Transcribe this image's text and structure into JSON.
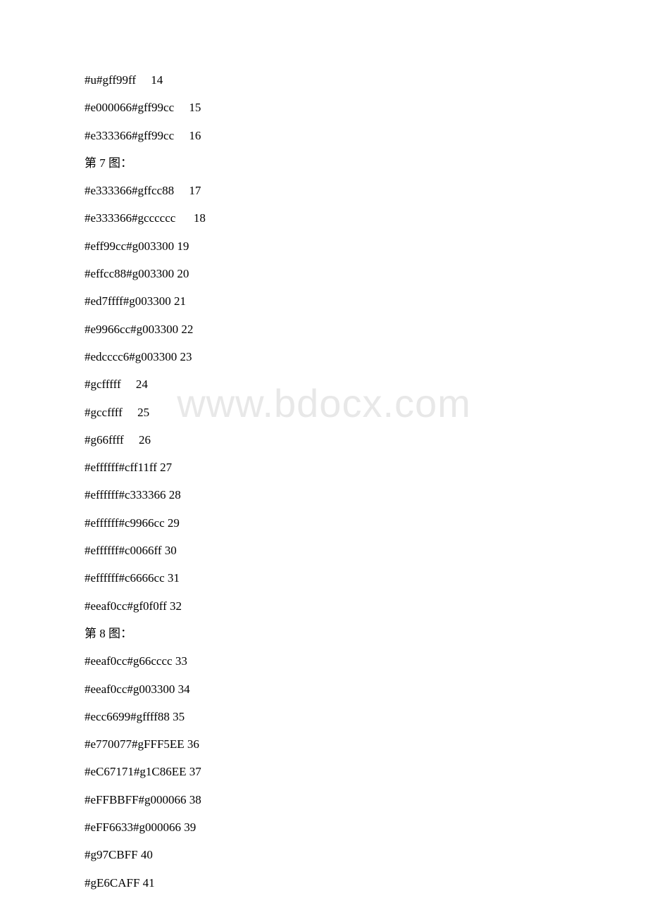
{
  "watermark": "www.bdocx.com",
  "lines": [
    "#u#gff99ff     14",
    "#e000066#gff99cc     15",
    "#e333366#gff99cc     16",
    "第 7 图：",
    "#e333366#gffcc88     17",
    "#e333366#gcccccc      18",
    "#eff99cc#g003300 19",
    "#effcc88#g003300 20",
    "#ed7ffff#g003300 21",
    "#e9966cc#g003300 22",
    "#edcccc6#g003300 23",
    "#gcfffff     24",
    "#gccffff     25",
    "#g66ffff     26",
    "#effffff#cff11ff 27",
    "#effffff#c333366 28",
    "#effffff#c9966cc 29",
    "#effffff#c0066ff 30",
    "#effffff#c6666cc 31",
    "#eeaf0cc#gf0f0ff 32",
    "第 8 图：",
    "#eeaf0cc#g66cccc 33",
    "#eeaf0cc#g003300 34",
    "#ecc6699#gffff88 35",
    "#e770077#gFFF5EE 36",
    "#eC67171#g1C86EE 37",
    "#eFFBBFF#g000066 38",
    "#eFF6633#g000066 39",
    "#g97CBFF 40",
    "#gE6CAFF 41"
  ]
}
